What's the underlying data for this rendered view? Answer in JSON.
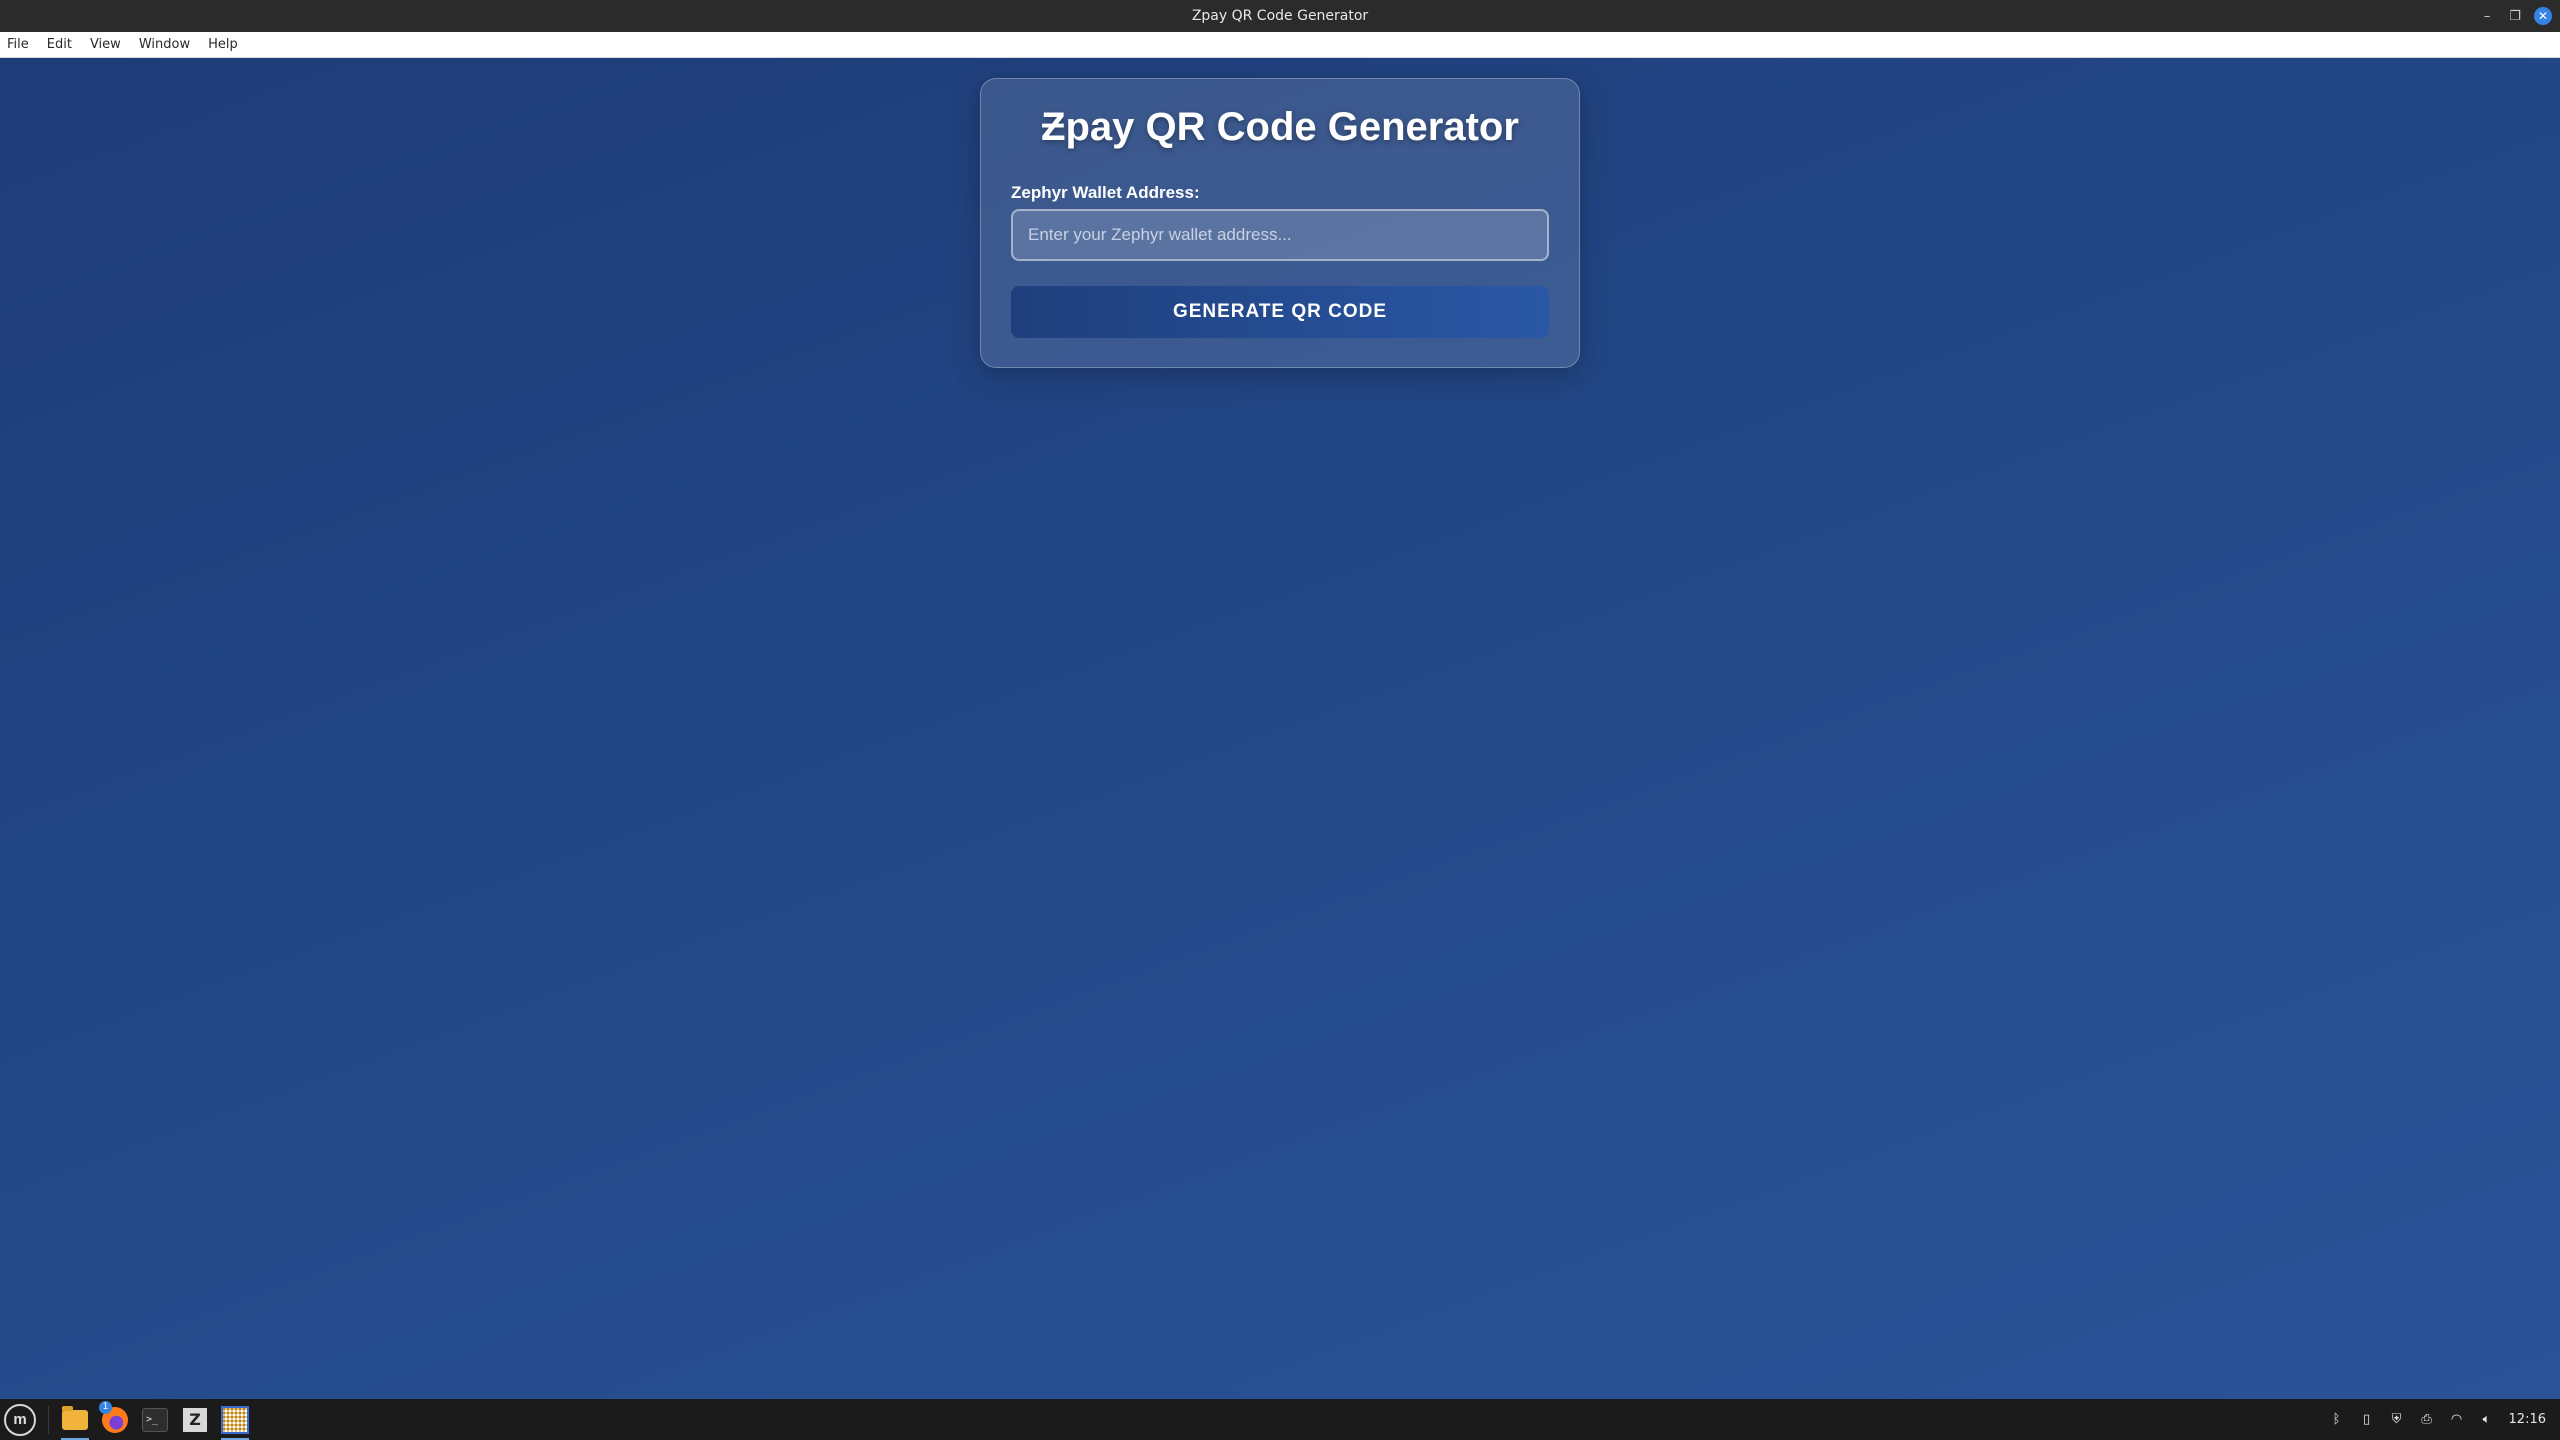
{
  "window": {
    "title": "Zpay QR Code Generator",
    "minimize_glyph": "–",
    "maximize_glyph": "❐",
    "close_glyph": "✕"
  },
  "menubar": {
    "items": [
      {
        "label": "File"
      },
      {
        "label": "Edit"
      },
      {
        "label": "View"
      },
      {
        "label": "Window"
      },
      {
        "label": "Help"
      }
    ]
  },
  "app": {
    "title": "Ƶpay QR Code Generator",
    "wallet_label": "Zephyr Wallet Address:",
    "wallet_value": "",
    "wallet_placeholder": "Enter your Zephyr wallet address...",
    "generate_button": "GENERATE QR CODE"
  },
  "taskbar": {
    "start_icon": "linux-mint-menu-icon",
    "apps": [
      {
        "icon": "file-manager-icon",
        "active": true
      },
      {
        "icon": "firefox-icon",
        "badge": "1"
      },
      {
        "icon": "terminal-icon"
      },
      {
        "icon": "zed-editor-icon",
        "glyph": "Z"
      },
      {
        "icon": "qr-generator-icon",
        "active": true
      }
    ],
    "tray": {
      "icons": [
        "bluetooth-icon",
        "clipboard-icon",
        "shield-icon",
        "printer-icon",
        "wifi-icon",
        "volume-icon"
      ],
      "clock": "12:16"
    }
  },
  "colors": {
    "titlebar": "#2b2b2b",
    "app_background": "#1f3f7a",
    "button_gradient_end": "#2a58a6",
    "close_button": "#3584e4",
    "taskbar": "#1b1b1b"
  }
}
